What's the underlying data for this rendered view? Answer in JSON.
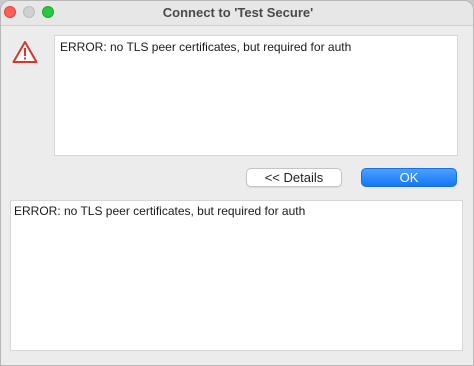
{
  "window": {
    "title": "Connect to 'Test Secure'"
  },
  "alert": {
    "icon": "warning-triangle-icon",
    "message": "ERROR: no TLS peer certificates, but required for auth"
  },
  "buttons": {
    "details_label": "<< Details",
    "ok_label": "OK"
  },
  "details": {
    "text": "ERROR: no TLS peer certificates, but required for auth"
  },
  "colors": {
    "accent": "#1577f5",
    "warning": "#d9352c"
  }
}
